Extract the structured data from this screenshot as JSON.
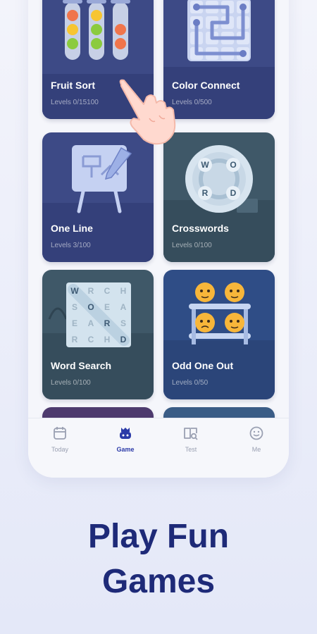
{
  "games": [
    {
      "title": "Fruit Sort",
      "levels": "Levels 0/15100"
    },
    {
      "title": "Color Connect",
      "levels": "Levels 0/500"
    },
    {
      "title": "One Line",
      "levels": "Levels 3/100"
    },
    {
      "title": "Crosswords",
      "levels": "Levels 0/100"
    },
    {
      "title": "Word Search",
      "levels": "Levels 0/100"
    },
    {
      "title": "Odd One Out",
      "levels": "Levels 0/50"
    }
  ],
  "crossword_letters": [
    "W",
    "O",
    "R",
    "D"
  ],
  "wordsearch_grid": [
    [
      "W",
      "R",
      "C",
      "H"
    ],
    [
      "S",
      "O",
      "E",
      "A"
    ],
    [
      "E",
      "A",
      "R",
      "S"
    ],
    [
      "R",
      "C",
      "H",
      "D"
    ]
  ],
  "tabs": [
    {
      "label": "Today",
      "icon": "calendar-icon"
    },
    {
      "label": "Game",
      "icon": "gamepad-icon",
      "active": true
    },
    {
      "label": "Test",
      "icon": "book-search-icon"
    },
    {
      "label": "Me",
      "icon": "smiley-icon"
    }
  ],
  "headline": {
    "line1": "Play Fun",
    "line2": "Games"
  },
  "colors": {
    "accent": "#2b3aa8",
    "headline": "#1e2a78"
  }
}
